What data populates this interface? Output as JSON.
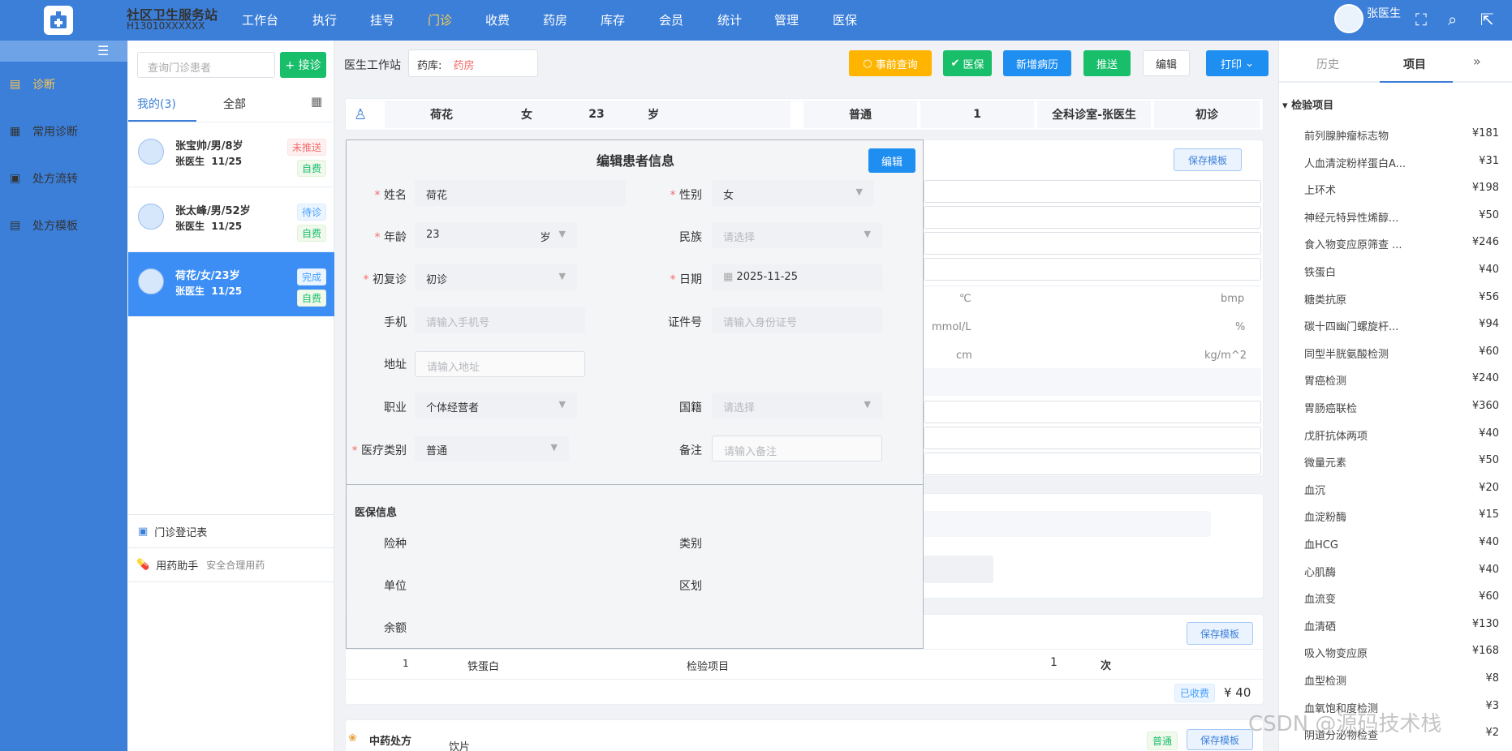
{
  "brand": {
    "title": "社区卫生服务站",
    "code": "H13010XXXXXX"
  },
  "nav": [
    "工作台",
    "执行",
    "挂号",
    "门诊",
    "收费",
    "药房",
    "库存",
    "会员",
    "统计",
    "管理",
    "医保"
  ],
  "nav_active": "门诊",
  "user": {
    "name": "张医生"
  },
  "sidebar": [
    {
      "label": "诊断",
      "active": true
    },
    {
      "label": "常用诊断"
    },
    {
      "label": "处方流转"
    },
    {
      "label": "处方模板"
    }
  ],
  "patient_panel": {
    "search_placeholder": "查询门诊患者",
    "receive_btn": "+ 接诊",
    "tab_mine": "我的(3)",
    "tab_all": "全部",
    "patients": [
      {
        "name": "张宝帅/男/8岁",
        "doctor": "张医生",
        "date": "11/25",
        "status": "未推送",
        "pay": "自费"
      },
      {
        "name": "张太峰/男/52岁",
        "doctor": "张医生",
        "date": "11/25",
        "status": "待诊",
        "pay": "自费"
      },
      {
        "name": "荷花/女/23岁",
        "doctor": "张医生",
        "date": "11/25",
        "status": "完成",
        "pay": "自费"
      }
    ],
    "register_link": "门诊登记表",
    "med_helper": "用药助手",
    "med_helper_sub": "安全合理用药"
  },
  "header": {
    "station": "医生工作站",
    "pharmacy_label": "药库:",
    "pharmacy_value": "药房",
    "buttons": {
      "prior_query": "事前查询",
      "insurance": "医保",
      "new_record": "新增病历",
      "push": "推送",
      "edit": "编辑",
      "print": "打印"
    }
  },
  "info_bar": {
    "name": "荷花",
    "sex": "女",
    "age": "23",
    "age_unit": "岁",
    "category": "普通",
    "number": "1",
    "dept": "全科诊室-张医生",
    "visit": "初诊"
  },
  "save_template": "保存模板",
  "vitals_units": [
    "℃",
    "bmp",
    "mmol/L",
    "%",
    "cm",
    "kg/m^2"
  ],
  "modal": {
    "title": "编辑患者信息",
    "edit_btn": "编辑",
    "fields": {
      "name": {
        "label": "姓名",
        "value": "荷花"
      },
      "sex": {
        "label": "性别",
        "value": "女"
      },
      "age": {
        "label": "年龄",
        "value": "23",
        "unit": "岁"
      },
      "ethnic": {
        "label": "民族",
        "placeholder": "请选择"
      },
      "visit": {
        "label": "初复诊",
        "value": "初诊"
      },
      "date": {
        "label": "日期",
        "value": "2025-11-25"
      },
      "phone": {
        "label": "手机",
        "placeholder": "请输入手机号"
      },
      "idno": {
        "label": "证件号",
        "placeholder": "请输入身份证号"
      },
      "address": {
        "label": "地址",
        "placeholder": "请输入地址"
      },
      "job": {
        "label": "职业",
        "value": "个体经营者"
      },
      "nation": {
        "label": "国籍",
        "placeholder": "请选择"
      },
      "medtype": {
        "label": "医疗类别",
        "value": "普通"
      },
      "remark": {
        "label": "备注",
        "placeholder": "请输入备注"
      }
    },
    "insurance": {
      "title": "医保信息",
      "type": "险种",
      "category": "类别",
      "unit": "单位",
      "region": "区划",
      "balance": "余额"
    }
  },
  "exam_row": {
    "index": "1",
    "name": "铁蛋白",
    "type": "检验项目",
    "qty": "1",
    "qty_unit": "次",
    "paid": "已收费",
    "price": "¥ 40"
  },
  "herbal": {
    "title": "中药处方",
    "kind": "饮片",
    "tag": "普通",
    "save": "保存模板"
  },
  "right_panel": {
    "tab_history": "历史",
    "tab_items": "项目",
    "section": "检验项目",
    "items": [
      {
        "name": "前列腺肿瘤标志物",
        "price": "¥181"
      },
      {
        "name": "人血清淀粉样蛋白A...",
        "price": "¥31"
      },
      {
        "name": "上环术",
        "price": "¥198"
      },
      {
        "name": "神经元特异性烯醇...",
        "price": "¥50"
      },
      {
        "name": "食入物变应原筛查 ...",
        "price": "¥246"
      },
      {
        "name": "铁蛋白",
        "price": "¥40"
      },
      {
        "name": "糖类抗原",
        "price": "¥56"
      },
      {
        "name": "碳十四幽门螺旋杆...",
        "price": "¥94"
      },
      {
        "name": "同型半胱氨酸检测",
        "price": "¥60"
      },
      {
        "name": "胃癌检测",
        "price": "¥240"
      },
      {
        "name": "胃肠癌联检",
        "price": "¥360"
      },
      {
        "name": "戊肝抗体两项",
        "price": "¥40"
      },
      {
        "name": "微量元素",
        "price": "¥50"
      },
      {
        "name": "血沉",
        "price": "¥20"
      },
      {
        "name": "血淀粉酶",
        "price": "¥15"
      },
      {
        "name": "血HCG",
        "price": "¥40"
      },
      {
        "name": "心肌酶",
        "price": "¥40"
      },
      {
        "name": "血流变",
        "price": "¥60"
      },
      {
        "name": "血清硒",
        "price": "¥130"
      },
      {
        "name": "吸入物变应原",
        "price": "¥168"
      },
      {
        "name": "血型检测",
        "price": "¥8"
      },
      {
        "name": "血氧饱和度检测",
        "price": "¥3"
      },
      {
        "name": "阴道分泌物检查",
        "price": "¥2"
      }
    ]
  },
  "watermark": "CSDN @源码技术栈"
}
